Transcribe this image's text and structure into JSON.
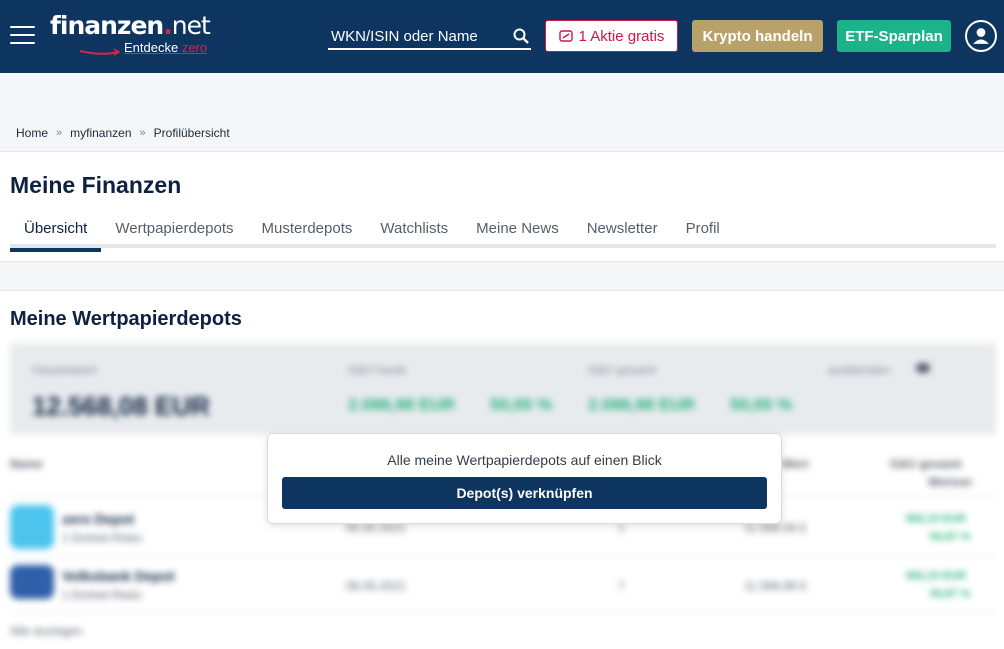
{
  "header": {
    "logo_main": "finanzen",
    "logo_dot": ".",
    "logo_net": "net",
    "logo_sub": "Entdecke ",
    "logo_sub_zero": "zero",
    "search_placeholder": "WKN/ISIN oder Name",
    "btn_aktie": "1 Aktie gratis",
    "btn_krypto": "Krypto handeln",
    "btn_etf": "ETF-Sparplan",
    "colors": {
      "navy": "#0d3560",
      "red": "#d0164a",
      "gold": "#b9a26a",
      "green": "#1db38a"
    }
  },
  "breadcrumb": [
    "Home",
    "myfinanzen",
    "Profilübersicht"
  ],
  "page_title": "Meine Finanzen",
  "tabs": [
    {
      "label": "Übersicht",
      "active": true
    },
    {
      "label": "Wertpapierdepots"
    },
    {
      "label": "Musterdepots"
    },
    {
      "label": "Watchlists"
    },
    {
      "label": "Meine News"
    },
    {
      "label": "Newsletter"
    },
    {
      "label": "Profil"
    }
  ],
  "section_title": "Meine Wertpapierdepots",
  "blurred": {
    "label_total": "Gesamtwert",
    "total": "12.568,08 EUR",
    "label_today": "G&V heute",
    "today_abs": "2.086,98 EUR",
    "today_pct": "50,00 %",
    "label_overall": "G&V gesamt",
    "overall_abs": "2.086,98 EUR",
    "overall_pct": "50,00 %",
    "label_hide": "ausblenden",
    "col_name": "Name",
    "col_value": "Wert",
    "col_gv": "G&V gesamt",
    "col_gv2": "Wertver",
    "rows": [
      {
        "name": "zero Depot",
        "sub": "1 Einheit Risko",
        "date": "05.05.2021",
        "count": "1",
        "value": "11.589,99 €",
        "gv_abs": "982,15 EUR",
        "gv_pct": "50,87 %"
      },
      {
        "name": "Volksbank Depot",
        "sub": "1 Einheit Risko",
        "date": "06.05.2021",
        "count": "7",
        "value": "11.589,99 €",
        "gv_abs": "982,15 EUR",
        "gv_pct": "50,87 %"
      }
    ],
    "show_more": "Alle anzeigen"
  },
  "overlay": {
    "text": "Alle meine Wertpapierdepots auf einen Blick",
    "button": "Depot(s) verknüpfen"
  }
}
